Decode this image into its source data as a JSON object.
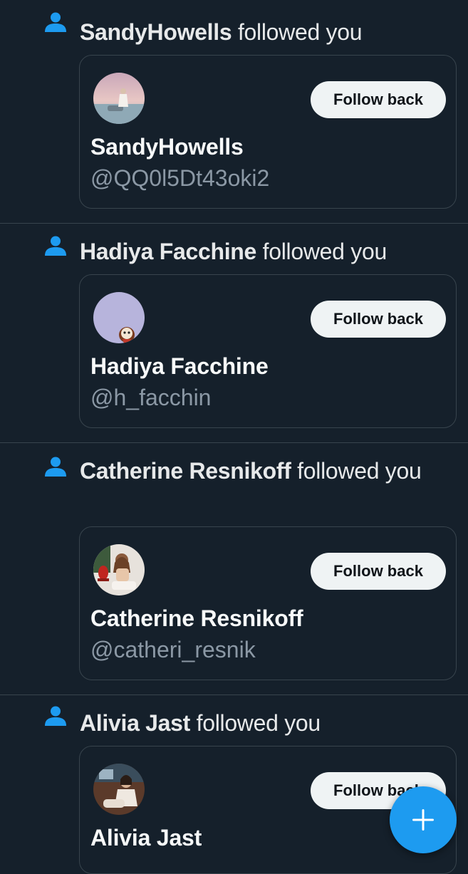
{
  "colors": {
    "background": "#15202b",
    "accent": "#1d9bf0",
    "text_primary": "#e7e9ea",
    "text_secondary": "#8b98a5",
    "border": "#38444d",
    "button_bg": "#eff3f4"
  },
  "notifications": [
    {
      "icon": "person-icon",
      "name": "SandyHowells",
      "action": " followed you",
      "card": {
        "display_name": "SandyHowells",
        "handle": "@QQ0l5Dt43oki2",
        "button_label": "Follow back"
      }
    },
    {
      "icon": "person-icon",
      "name": "Hadiya Facchine",
      "action": " followed you",
      "card": {
        "display_name": "Hadiya Facchine",
        "handle": "@h_facchin",
        "button_label": "Follow back"
      }
    },
    {
      "icon": "person-icon",
      "name": "Catherine Resnikoff",
      "action": " followed you",
      "card": {
        "display_name": "Catherine Resnikoff",
        "handle": "@catheri_resnik",
        "button_label": "Follow back"
      }
    },
    {
      "icon": "person-icon",
      "name": "Alivia Jast",
      "action": " followed you",
      "card": {
        "display_name": "Alivia Jast",
        "handle": "",
        "button_label": "Follow back"
      }
    }
  ],
  "fab": {
    "icon": "plus-icon"
  }
}
